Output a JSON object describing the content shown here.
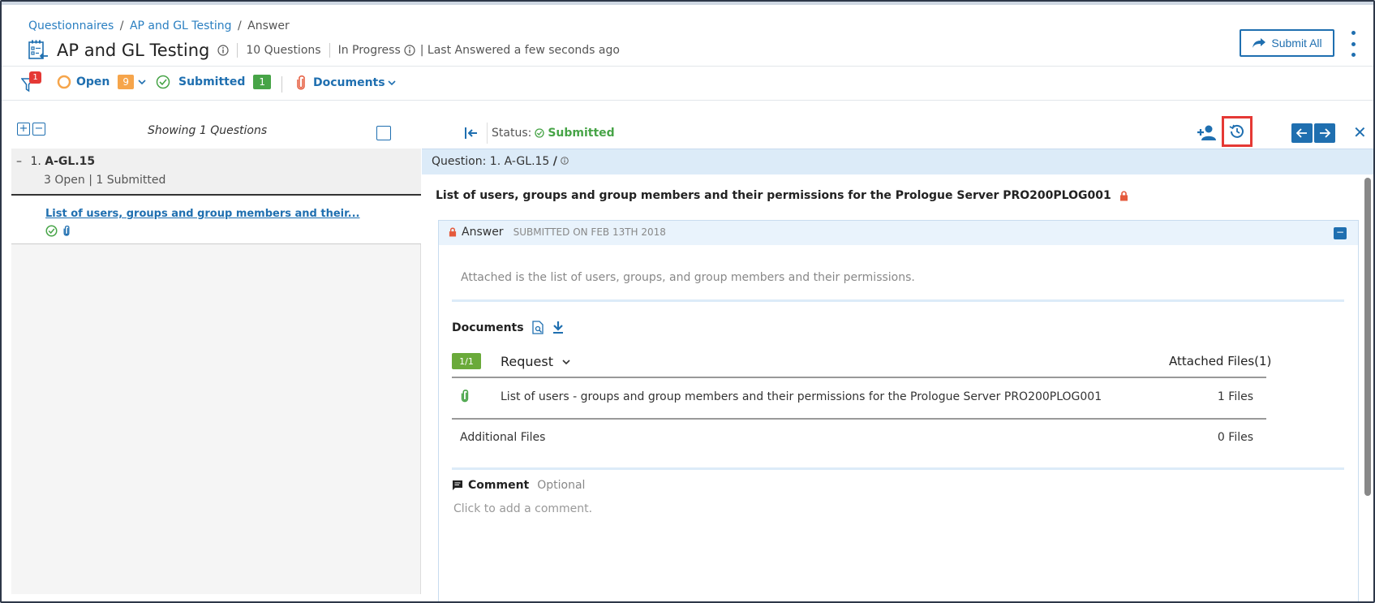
{
  "breadcrumb": {
    "item1": "Questionnaires",
    "item2": "AP and GL Testing",
    "current": "Answer",
    "separator": "/"
  },
  "header": {
    "title": "AP and GL Testing",
    "question_count": "10 Questions",
    "status": "In Progress",
    "last_answered": "| Last Answered a few seconds ago",
    "submit_all": "Submit All"
  },
  "filterbar": {
    "filter_badge": "1",
    "open_label": "Open",
    "open_count": "9",
    "submitted_label": "Submitted",
    "submitted_count": "1",
    "documents_label": "Documents"
  },
  "left": {
    "expand": "+",
    "collapse": "−",
    "showing": "Showing 1 Questions",
    "group_toggle": "–",
    "group_number": "1.",
    "group_id": "A-GL.15",
    "group_summary": "3  Open | 1 Submitted",
    "question_link": "List of users, groups and group members and their..."
  },
  "right": {
    "status_label": "Status:",
    "status_value": "Submitted",
    "question_bar": "Question: 1. A-GL.15",
    "question_bar_sep": "/",
    "question_text": "List of users, groups and group members and their permissions for the Prologue Server PRO200PLOG001",
    "answer_label": "Answer",
    "answer_date": "SUBMITTED ON FEB 13TH 2018",
    "answer_minus": "−",
    "answer_body": "Attached is the list of users, groups, and group members and their permissions.",
    "documents_title": "Documents",
    "doc_fraction": "1/1",
    "request_header": "Request",
    "attached_header": "Attached Files(1)",
    "doc_rows": [
      {
        "name": "List of users - groups and group members and their permissions for the Prologue Server PRO200PLOG001",
        "files": "1 Files"
      },
      {
        "name": "Additional Files",
        "files": "0 Files"
      }
    ],
    "comment_title": "Comment",
    "comment_optional": "Optional",
    "comment_placeholder": "Click to add a comment.",
    "close": "✕"
  },
  "colors": {
    "primary_blue": "#1f6fb0",
    "success_green": "#47a447",
    "open_orange": "#f6a54b",
    "alert_red": "#e53935",
    "highlight_bar": "#dcebf8"
  }
}
